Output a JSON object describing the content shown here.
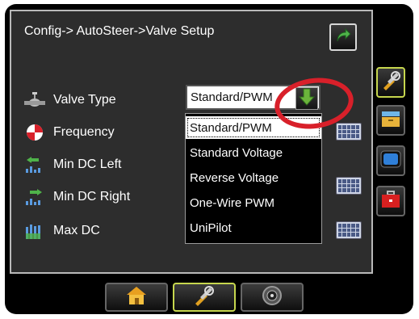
{
  "breadcrumb": "Config-> AutoSteer->Valve Setup",
  "settings": [
    {
      "label": "Valve Type",
      "icon": "valve-icon"
    },
    {
      "label": "Frequency",
      "icon": "frequency-icon"
    },
    {
      "label": "Min DC Left",
      "icon": "min-dc-left-icon"
    },
    {
      "label": "Min DC Right",
      "icon": "min-dc-right-icon"
    },
    {
      "label": "Max DC",
      "icon": "max-dc-icon"
    }
  ],
  "valve_type": {
    "selected": "Standard/PWM",
    "options": [
      "Standard/PWM",
      "Standard Voltage",
      "Reverse Voltage",
      "One-Wire PWM",
      "UniPilot"
    ]
  },
  "right_tabs": [
    "tools-icon",
    "storage-icon",
    "display-icon",
    "toolbox-icon"
  ],
  "bottom_tabs": [
    "home-icon",
    "tools-icon",
    "gauge-icon"
  ],
  "colors": {
    "accent": "#c6d64e",
    "highlight": "#d8202a",
    "arrow": "#6bb33b"
  }
}
